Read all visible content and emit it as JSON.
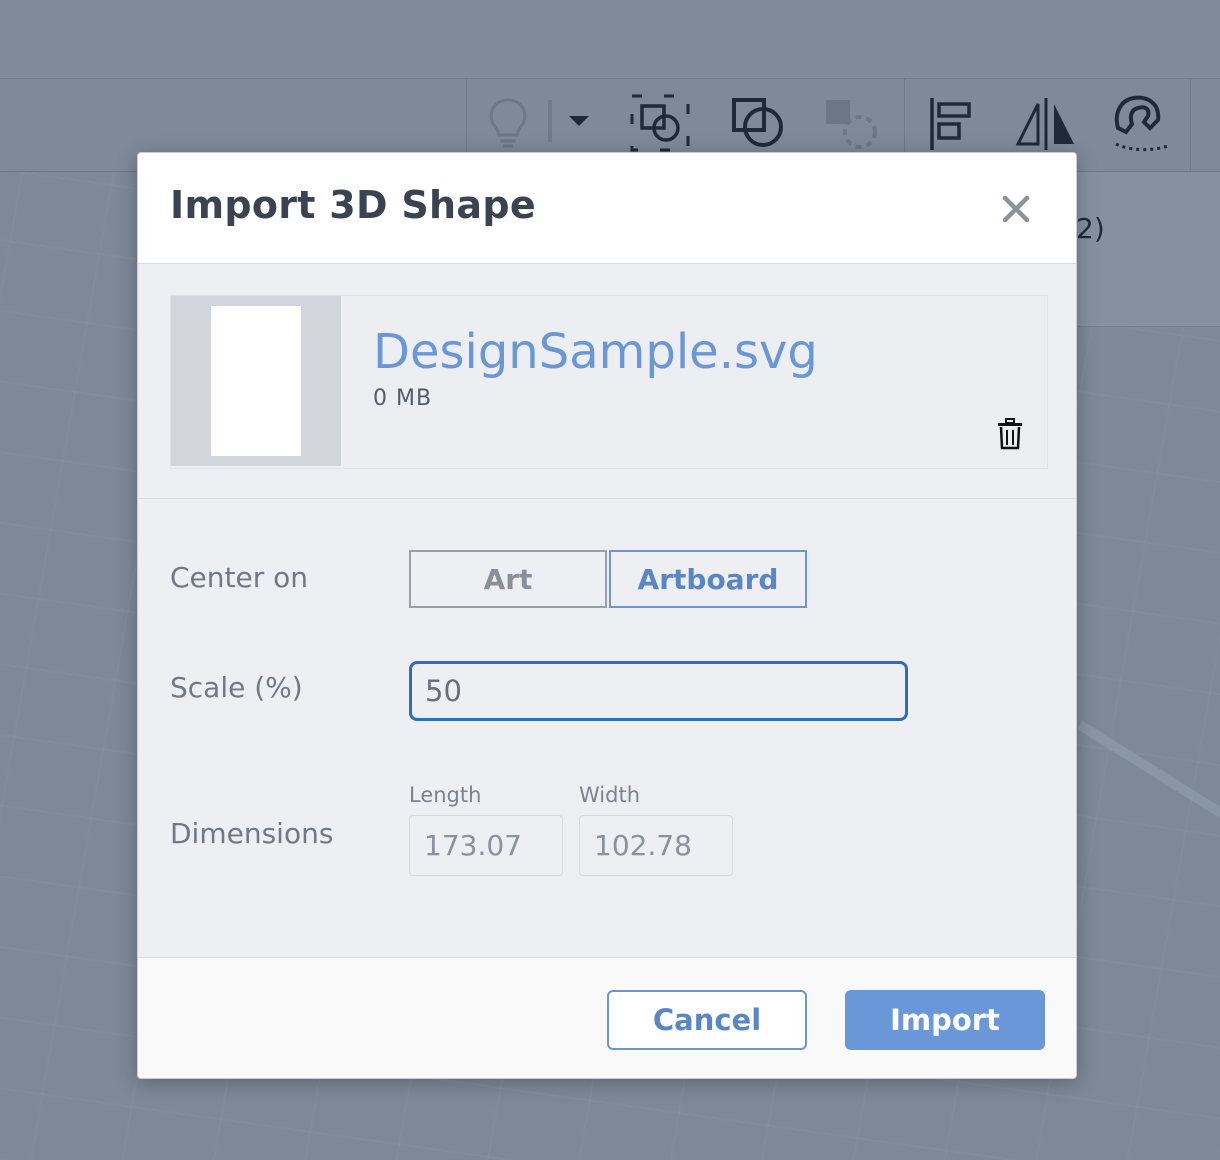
{
  "background": {
    "panel_text": "2)",
    "toolbar_icons": [
      "lightbulb-icon",
      "dropdown-arrow-icon",
      "group-shapes-icon",
      "ungroup-shapes-icon",
      "hole-shapes-icon",
      "align-icon",
      "mirror-icon",
      "magnet-icon"
    ]
  },
  "dialog": {
    "title": "Import 3D Shape",
    "close_icon": "close-icon",
    "file": {
      "name": "DesignSample.svg",
      "size": "0 MB",
      "delete_icon": "trash-icon"
    },
    "center_on": {
      "label": "Center on",
      "options": [
        "Art",
        "Artboard"
      ],
      "selected": "Artboard"
    },
    "scale": {
      "label": "Scale (%)",
      "value": "50"
    },
    "dimensions": {
      "label": "Dimensions",
      "length_label": "Length",
      "length_value": "173.07",
      "width_label": "Width",
      "width_value": "102.78"
    },
    "buttons": {
      "cancel": "Cancel",
      "import": "Import"
    }
  },
  "colors": {
    "accent": "#6a97d8",
    "focus_border": "#2e6cbf",
    "file_name": "#6b97d6"
  }
}
